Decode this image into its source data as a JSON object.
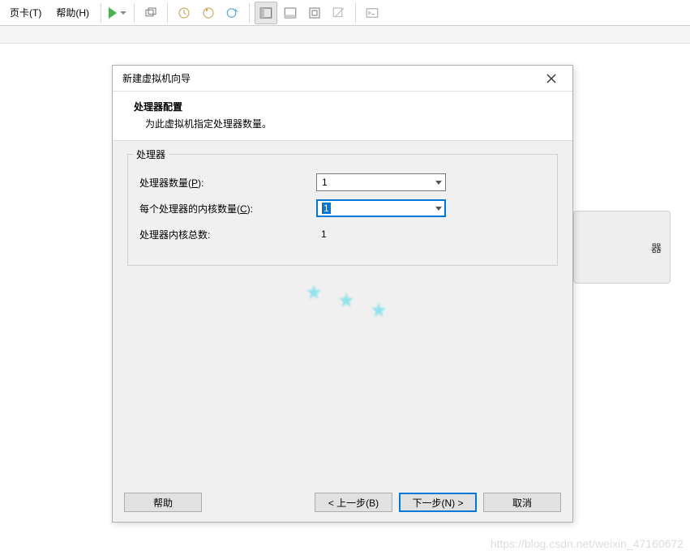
{
  "menus": {
    "tab": "页卡(T)",
    "help": "帮助(H)"
  },
  "bg_label": "器",
  "dialog": {
    "title": "新建虚拟机向导",
    "heading": "处理器配置",
    "subheading": "为此虚拟机指定处理器数量。",
    "group_title": "处理器",
    "row_processors": {
      "label_pre": "处理器数量(",
      "accel": "P",
      "label_post": "):",
      "value": "1"
    },
    "row_cores": {
      "label_pre": "每个处理器的内核数量(",
      "accel": "C",
      "label_post": "):",
      "value": "1"
    },
    "row_total": {
      "label": "处理器内核总数:",
      "value": "1"
    },
    "buttons": {
      "help": "帮助",
      "back": "< 上一步(B)",
      "next": "下一步(N) >",
      "cancel": "取消"
    }
  },
  "blog_watermark": "https://blog.csdn.net/weixin_47160672"
}
